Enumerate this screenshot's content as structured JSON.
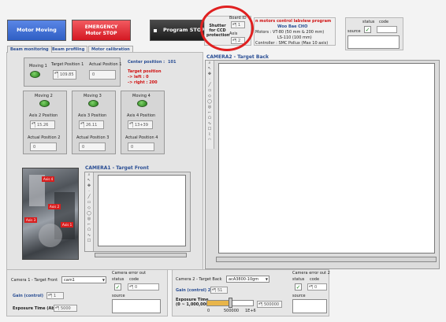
{
  "toolbar": {
    "motor_moving": "Motor Moving",
    "emergency": "EMERGENCY\nMotor STOP",
    "program_stop": "Program STOP"
  },
  "shutter": {
    "label": "Shutter for CCD protection",
    "board_id_label": "Board ID",
    "board_id": "1",
    "axis_label": "Axis",
    "axis": "2"
  },
  "info": {
    "title": "n motors control labview program",
    "author": "Woo Bae CHO",
    "line1": "Motors : VT-80 (50 mm & 200 mm)",
    "line2": "LS-110 (100 mm)",
    "line3": "Controller : SMC Pollux (Max 10 axis)"
  },
  "status_top": {
    "status": "status",
    "code": "code",
    "source": "source"
  },
  "tabs": [
    "Beam monitoring",
    "Beam profiling",
    "Motor calibration"
  ],
  "moving1": {
    "label": "Moving 1",
    "target_label": "Target Position 1",
    "target": "109.85",
    "actual_label": "Actual Position 1",
    "actual": "0"
  },
  "center": {
    "label": "Center position :",
    "value": "101",
    "target_label": "Target position",
    "left": "-> left : 0",
    "right": "-> right : 200"
  },
  "axes": [
    {
      "moving": "Moving 2",
      "pos_label": "Axis 2 Position",
      "pos": "15.26",
      "act_label": "Actual Position 2",
      "act": "0"
    },
    {
      "moving": "Moving 3",
      "pos_label": "Axis 3 Position",
      "pos": "26.11",
      "act_label": "Actual Position 3",
      "act": "0"
    },
    {
      "moving": "Moving 4",
      "pos_label": "Axis 4 Position",
      "pos": "13+39",
      "act_label": "Actual Position 4",
      "act": "0"
    }
  ],
  "camera1": {
    "title": "CAMERA1 - Target Front"
  },
  "camera2": {
    "title": "CAMERA2 - Target Back"
  },
  "photo_labels": [
    "Axis 4",
    "Axis 2",
    "Axis 3",
    "Axis 1"
  ],
  "bottom1": {
    "cam_label": "Camera 1 - Target Front",
    "cam_value": "cam1",
    "gain_label": "Gain (control)",
    "gain": "1",
    "exp_label": "Exposure Time (Abs)",
    "exp": "5000",
    "err_title": "Camera error out",
    "status": "status",
    "code": "code",
    "code_value": "0",
    "source": "source"
  },
  "bottom2": {
    "cam_label": "Camera 2 - Target Back",
    "cam_value": "acA3800-10gm",
    "gain_label": "Gain (control) 2",
    "gain": "51",
    "exp_label": "Exposure Time",
    "exp_range": "(0 ~ 1,000,000)",
    "exp": "500000",
    "slider_min": "0",
    "slider_mid": "500000",
    "slider_max": "1E+6",
    "slider_level": 0.5,
    "err_title": "Camera error out 2",
    "status": "status",
    "code": "code",
    "code_value": "0",
    "source": "source"
  },
  "colors": {
    "blue_button": "#2f5fc4",
    "red_button": "#e0202a",
    "dark_button": "#2b2b2b",
    "led": "#2f9a1f",
    "annotation": "#e02020"
  }
}
